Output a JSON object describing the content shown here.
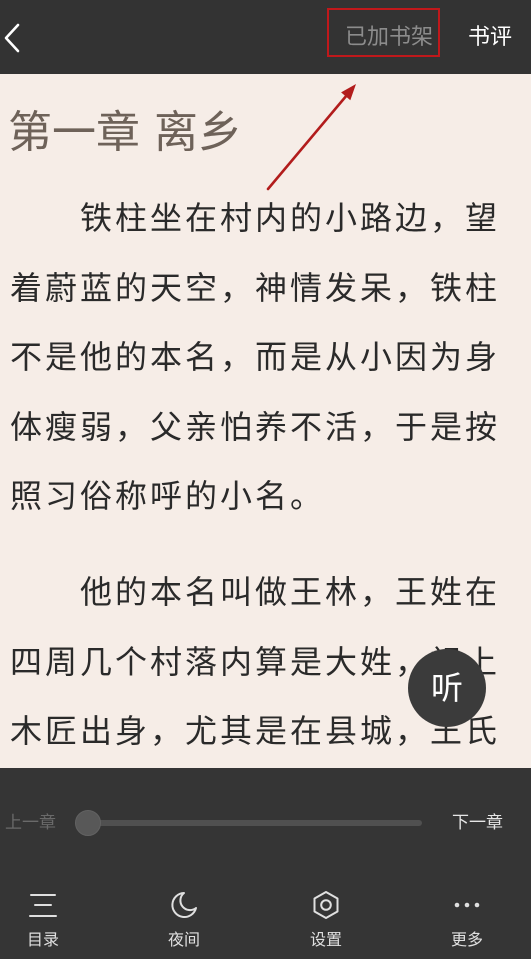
{
  "top_bar": {
    "back_icon": "chevron-left-icon",
    "bookshelf_status": "已加书架",
    "review_label": "书评"
  },
  "chapter": {
    "title": "第一章 离乡",
    "paragraphs": [
      {
        "lines": [
          "铁柱坐在村内的小路边，望",
          "着蔚蓝的天空，神情发呆，铁柱",
          "不是他的本名，而是从小因为身",
          "体瘦弱，父亲怕养不活，于是按",
          "照习俗称呼的小名。"
        ]
      },
      {
        "lines": [
          "他的本名叫做王林，王姓在",
          "四周几个村落内算是大姓，祖上",
          "木匠出身，尤其是在县城，王氏"
        ]
      }
    ]
  },
  "listen_button": {
    "label": "听"
  },
  "progress": {
    "prev_chapter_label": "上一章",
    "next_chapter_label": "下一章",
    "value": 0
  },
  "toolbar": {
    "items": [
      {
        "label": "目录",
        "icon": "list-icon"
      },
      {
        "label": "夜间",
        "icon": "moon-icon"
      },
      {
        "label": "设置",
        "icon": "settings-icon"
      },
      {
        "label": "更多",
        "icon": "more-dots-icon"
      }
    ]
  },
  "colors": {
    "top_bar_bg": "#333333",
    "bottom_panel_bg": "#353535",
    "page_bg": "#f6ede7",
    "body_text": "#2a2a2a",
    "title_text": "#6e6259",
    "annotation": "#c0181b"
  }
}
